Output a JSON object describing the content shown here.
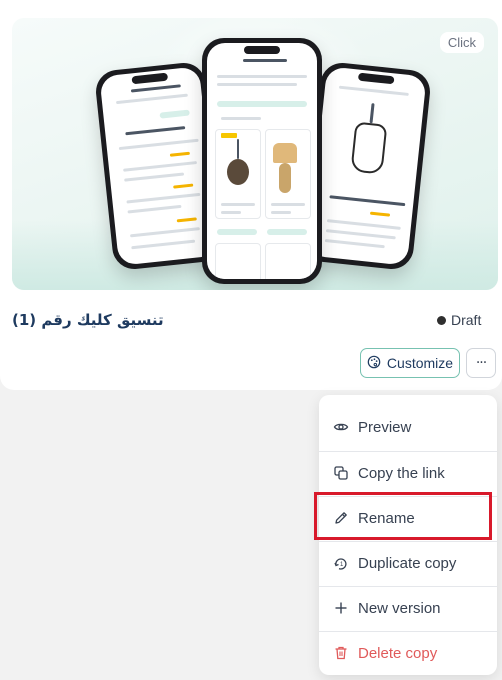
{
  "card": {
    "preview_badge": "Click",
    "title": "تنسيق كليك رقم (1)",
    "status": "Draft",
    "customize_label": "Customize",
    "more_label": "···"
  },
  "menu": {
    "items": [
      {
        "label": "Preview",
        "icon": "eye-icon"
      },
      {
        "label": "Copy the link",
        "icon": "copy-link-icon"
      },
      {
        "label": "Rename",
        "icon": "pencil-icon"
      },
      {
        "label": "Duplicate copy",
        "icon": "duplicate-icon"
      },
      {
        "label": "New version",
        "icon": "plus-icon"
      },
      {
        "label": "Delete copy",
        "icon": "trash-icon"
      }
    ]
  },
  "colors": {
    "accent": "#77c2b1",
    "title": "#1e3a5f",
    "danger": "#e05a5a",
    "highlight": "#d8192b"
  }
}
